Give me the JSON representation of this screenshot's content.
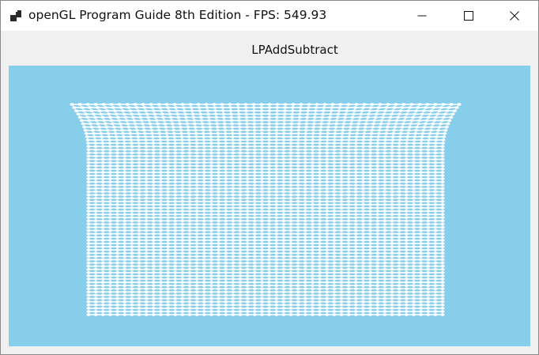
{
  "window": {
    "title": "openGL Program Guide 8th Edition - FPS: 549.93",
    "icon": "app-icon",
    "buttons": {
      "minimize": "minimize-icon",
      "maximize": "maximize-icon",
      "close": "close-icon"
    }
  },
  "canvas": {
    "label": "LPAddSubtract",
    "background_color": "#87CEEB",
    "mesh_color": "#FFFFFF",
    "content": "white particle grid (cloth mesh) flaring outward at the top"
  }
}
